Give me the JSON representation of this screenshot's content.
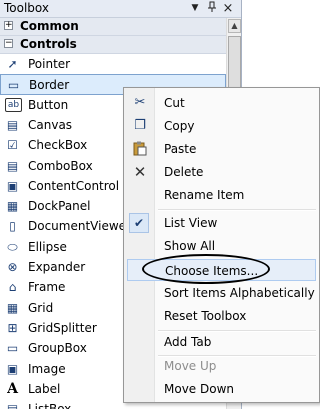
{
  "window": {
    "title": "Toolbox"
  },
  "titlebar_buttons": {
    "dropdown": "▼",
    "pin": "ᵯ",
    "close": "×"
  },
  "tabs": {
    "common": {
      "label": "Common",
      "expander": "+"
    },
    "controls": {
      "label": "Controls",
      "expander": "−"
    }
  },
  "items": [
    {
      "label": "Pointer",
      "icon": "pointer-icon",
      "glyph": "➚"
    },
    {
      "label": "Border",
      "icon": "border-icon",
      "glyph": "▭"
    },
    {
      "label": "Button",
      "icon": "button-icon",
      "glyph": "ab"
    },
    {
      "label": "Canvas",
      "icon": "canvas-icon",
      "glyph": "▤"
    },
    {
      "label": "CheckBox",
      "icon": "checkbox-icon",
      "glyph": "☑"
    },
    {
      "label": "ComboBox",
      "icon": "combobox-icon",
      "glyph": "▤"
    },
    {
      "label": "ContentControl",
      "icon": "content-control-icon",
      "glyph": "▣"
    },
    {
      "label": "DockPanel",
      "icon": "dockpanel-icon",
      "glyph": "▦"
    },
    {
      "label": "DocumentViewer",
      "icon": "document-viewer-icon",
      "glyph": "▯"
    },
    {
      "label": "Ellipse",
      "icon": "ellipse-icon",
      "glyph": "⬭"
    },
    {
      "label": "Expander",
      "icon": "expander-icon",
      "glyph": "⊗"
    },
    {
      "label": "Frame",
      "icon": "frame-icon",
      "glyph": "⌂"
    },
    {
      "label": "Grid",
      "icon": "grid-icon",
      "glyph": "▦"
    },
    {
      "label": "GridSplitter",
      "icon": "gridsplitter-icon",
      "glyph": "⊞"
    },
    {
      "label": "GroupBox",
      "icon": "groupbox-icon",
      "glyph": "▭"
    },
    {
      "label": "Image",
      "icon": "image-icon",
      "glyph": "▣"
    },
    {
      "label": "Label",
      "icon": "label-icon",
      "glyph": "A"
    },
    {
      "label": "ListBox",
      "icon": "listbox-icon",
      "glyph": "▤"
    }
  ],
  "context_menu": {
    "cut": {
      "label": "Cut",
      "glyph": "✂"
    },
    "copy": {
      "label": "Copy",
      "glyph": "❐"
    },
    "paste": {
      "label": "Paste",
      "glyph": "📋"
    },
    "delete": {
      "label": "Delete",
      "glyph": "✕"
    },
    "rename": {
      "label": "Rename Item"
    },
    "list_view": {
      "label": "List View",
      "check": "✔"
    },
    "show_all": {
      "label": "Show All"
    },
    "choose_items": {
      "label": "Choose Items..."
    },
    "sort": {
      "label": "Sort Items Alphabetically"
    },
    "reset": {
      "label": "Reset Toolbox"
    },
    "add_tab": {
      "label": "Add Tab"
    },
    "move_up": {
      "label": "Move Up"
    },
    "move_down": {
      "label": "Move Down"
    }
  },
  "colors": {
    "accent": "#3399ff",
    "selection_bg": "#dcecfc",
    "menu_gutter": "#f0f0f0"
  }
}
